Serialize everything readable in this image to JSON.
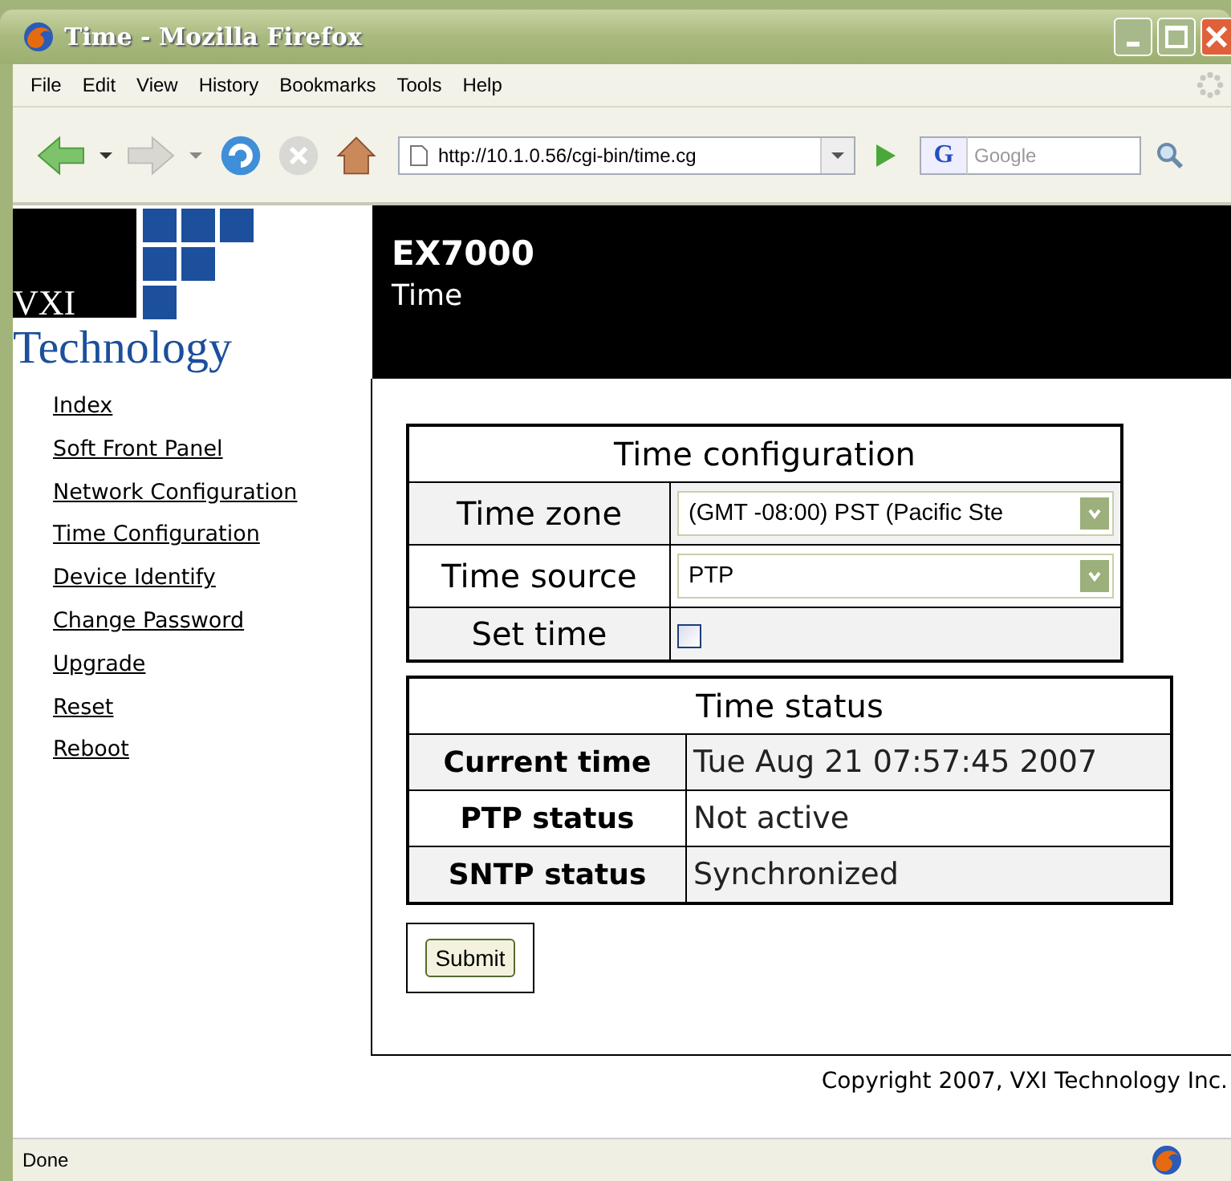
{
  "window": {
    "title": "Time - Mozilla Firefox"
  },
  "menu": [
    "File",
    "Edit",
    "View",
    "History",
    "Bookmarks",
    "Tools",
    "Help"
  ],
  "toolbar": {
    "url": "http://10.1.0.56/cgi-bin/time.cg",
    "search_engine": "G",
    "search_placeholder": "Google"
  },
  "logo": {
    "line_1": "VXI",
    "line_2": "Technology"
  },
  "header": {
    "title": "EX7000",
    "subtitle": "Time"
  },
  "sidebar": {
    "items": [
      "Index",
      "Soft Front Panel",
      "Network Configuration",
      "Time Configuration",
      "Device Identify",
      "Change Password",
      "Upgrade",
      "Reset",
      "Reboot"
    ]
  },
  "config_table": {
    "title": "Time configuration",
    "rows": [
      {
        "label": "Time zone",
        "kind": "select",
        "value": "(GMT -08:00) PST (Pacific Ste"
      },
      {
        "label": "Time source",
        "kind": "select",
        "value": "PTP"
      },
      {
        "label": "Set time",
        "kind": "checkbox",
        "checked": false
      }
    ]
  },
  "status_table": {
    "title": "Time status",
    "rows": [
      {
        "label": "Current time",
        "value": "Tue Aug 21 07:57:45 2007"
      },
      {
        "label": "PTP status",
        "value": "Not active"
      },
      {
        "label": "SNTP status",
        "value": "Synchronized"
      }
    ]
  },
  "submit": "Submit",
  "copyright": "Copyright 2007, VXI Technology Inc.",
  "status_bar": "Done"
}
